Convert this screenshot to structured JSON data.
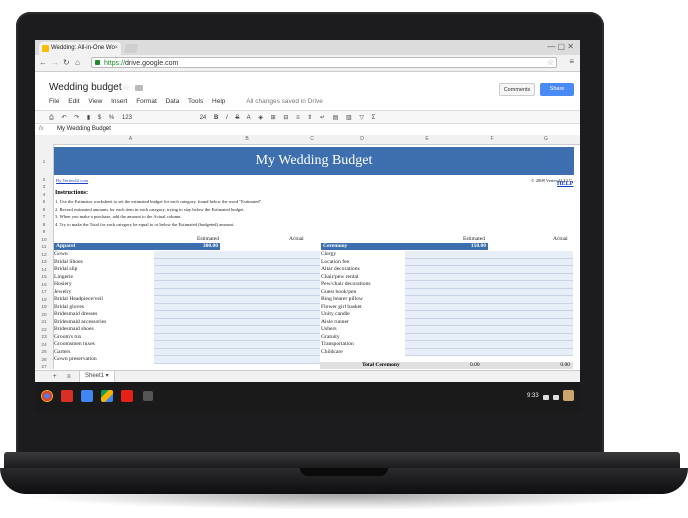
{
  "browser": {
    "tab_title": "Wedding: All-in-One Wo",
    "tab_close": "×",
    "url_scheme": "https://",
    "url_rest": "drive.google.com"
  },
  "doc": {
    "title": "Wedding budget",
    "menu": [
      "File",
      "Edit",
      "View",
      "Insert",
      "Format",
      "Data",
      "Tools",
      "Help"
    ],
    "saved_status": "All changes saved in Drive",
    "comments_label": "Comments",
    "share_label": "Share"
  },
  "toolbar": {
    "currency": "$",
    "percent": "%",
    "number_format": "123",
    "font_size": "24",
    "bold": "B",
    "italic": "I",
    "strike": "S",
    "text_color": "A"
  },
  "formula": {
    "fx": "fx",
    "value": "My Wedding Budget"
  },
  "columns": [
    "A",
    "B",
    "C",
    "D",
    "E",
    "F",
    "G"
  ],
  "rows": [
    "1",
    "2",
    "3",
    "4",
    "5",
    "6",
    "7",
    "8",
    "9",
    "10",
    "11",
    "12",
    "13",
    "14",
    "15",
    "16",
    "17",
    "18",
    "19",
    "20",
    "21",
    "22",
    "23",
    "24",
    "25",
    "26",
    "27"
  ],
  "sheet": {
    "banner": "My Wedding Budget",
    "site_link": "By Vertex42.com",
    "copyright": "© 2008 Vertex42 LLC",
    "help": "HELP",
    "instructions_title": "Instructions:",
    "instructions": [
      "1. Use the Estimator worksheet to set the estimated budget for each category, found below the word \"Estimated\".",
      "2. Record estimated amounts for each item in each category, trying to stay below the Estimated budget.",
      "3. When you make a purchase, add the amount to the Actual column.",
      "4. Try to make the Total for each category be equal to or below the Estimated (budgeted) amount."
    ],
    "estimated_label": "Estimated",
    "actual_label": "Actual",
    "apparel": {
      "header": "Apparel",
      "estimated": "300.00",
      "items": [
        "Gown",
        "Bridal Shoes",
        "Bridal slip",
        "Lingerie",
        "Hosiery",
        "Jewelry",
        "Bridal Headpiece/veil",
        "Bridal gloves",
        "Bridesmaid dresses",
        "Bridesmaid accessories",
        "Bridesmaid shoes",
        "Groom's tux",
        "Groomsmen tuxes",
        "Garters",
        "Gown preservation"
      ]
    },
    "ceremony": {
      "header": "Ceremony",
      "estimated": "150.00",
      "items": [
        "Clergy",
        "Location fee",
        "Altar decorations",
        "Chair/pew rental",
        "Pew/chair decorations",
        "Guest book/pen",
        "Ring bearer pillow",
        "Flower girl basket",
        "Unity candle",
        "Aisle runner",
        "Ushers",
        "Gratuity",
        "Transportation",
        "Childcare"
      ],
      "total_label": "Total Ceremony",
      "total_estimated": "0.00",
      "total_actual": "0.00"
    }
  },
  "sheet_tabs": {
    "add": "+",
    "list": "≡",
    "active": "Sheet1 ▾"
  },
  "shelf": {
    "time": "9:33"
  }
}
